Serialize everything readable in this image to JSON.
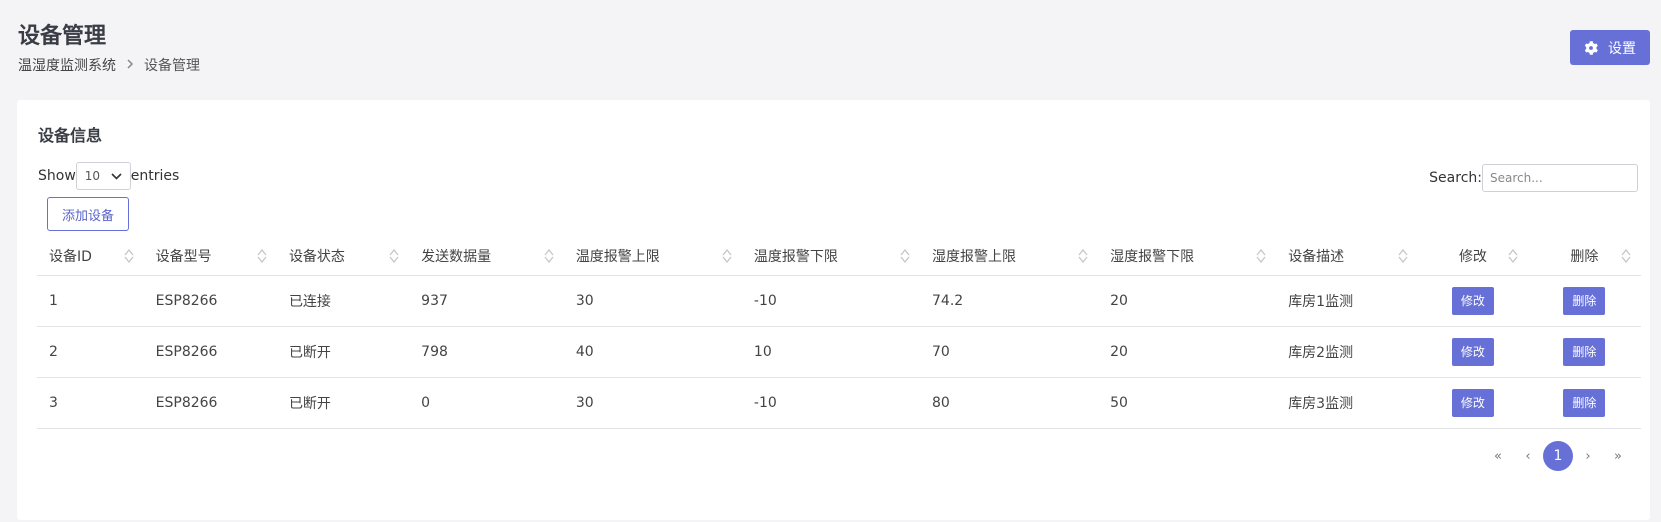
{
  "header": {
    "title": "设备管理",
    "breadcrumb": [
      "温湿度监测系统",
      "设备管理"
    ],
    "settings_label": "设置"
  },
  "card": {
    "title": "设备信息",
    "show_label": "Show",
    "page_length": "10",
    "entries_label": "entries",
    "search_label": "Search:",
    "search_placeholder": "Search...",
    "add_button": "添加设备"
  },
  "table": {
    "columns": [
      "设备ID",
      "设备型号",
      "设备状态",
      "发送数据量",
      "温度报警上限",
      "温度报警下限",
      "湿度报警上限",
      "湿度报警下限",
      "设备描述",
      "修改",
      "删除"
    ],
    "rows": [
      [
        "1",
        "ESP8266",
        "已连接",
        "937",
        "30",
        "-10",
        "74.2",
        "20",
        "库房1监测"
      ],
      [
        "2",
        "ESP8266",
        "已断开",
        "798",
        "40",
        "10",
        "70",
        "20",
        "库房2监测"
      ],
      [
        "3",
        "ESP8266",
        "已断开",
        "0",
        "30",
        "-10",
        "80",
        "50",
        "库房3监测"
      ]
    ],
    "edit_label": "修改",
    "delete_label": "删除"
  },
  "pagination": {
    "first": "«",
    "prev": "‹",
    "current": "1",
    "next": "›",
    "last": "»"
  },
  "colors": {
    "accent": "#6670d6",
    "background": "#f4f4f6",
    "card": "#ffffff"
  }
}
